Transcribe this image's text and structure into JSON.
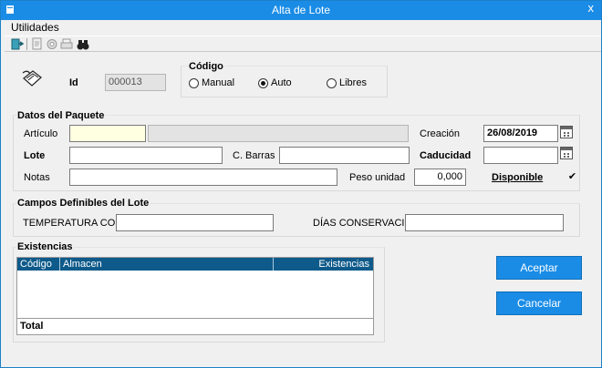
{
  "window": {
    "title": "Alta de Lote",
    "close_glyph": "x"
  },
  "menu": {
    "utilidades": "Utilidades"
  },
  "header": {
    "id_label": "Id",
    "id_value": "000013",
    "codigo_label": "Código",
    "radios": [
      {
        "label": "Manual",
        "selected": false
      },
      {
        "label": "Auto",
        "selected": true
      },
      {
        "label": "Libres",
        "selected": false
      }
    ]
  },
  "paquete": {
    "group_label": "Datos del Paquete",
    "articulo_label": "Artículo",
    "articulo_value": "",
    "articulo_desc": "",
    "creacion_label": "Creación",
    "creacion_value": "26/08/2019",
    "lote_label": "Lote",
    "lote_value": "",
    "cbarras_label": "C. Barras",
    "cbarras_value": "",
    "caducidad_label": "Caducidad",
    "caducidad_value": "",
    "notas_label": "Notas",
    "notas_value": "",
    "peso_label": "Peso unidad",
    "peso_value": "0,000",
    "disponible_label": "Disponible",
    "disponible_checked": true,
    "check_glyph": "✔"
  },
  "campos": {
    "group_label": "Campos Definibles del Lote",
    "temperatura_label": "TEMPERATURA CON",
    "temperatura_value": "",
    "dias_label": "DÍAS CONSERVACIÓ",
    "dias_value": ""
  },
  "existencias": {
    "group_label": "Existencias",
    "columns": [
      "Código",
      "Almacen",
      "Existencias"
    ],
    "rows": [],
    "total_label": "Total"
  },
  "buttons": {
    "aceptar": "Aceptar",
    "cancelar": "Cancelar"
  },
  "colors": {
    "titlebar": "#1a8ce6",
    "grid_header": "#0e5a8a",
    "button": "#1a8ce6"
  },
  "icons": [
    "exit-icon",
    "document-icon",
    "settings-icon",
    "print-icon",
    "binoculars-icon",
    "lot-icon",
    "calendar-icon"
  ]
}
